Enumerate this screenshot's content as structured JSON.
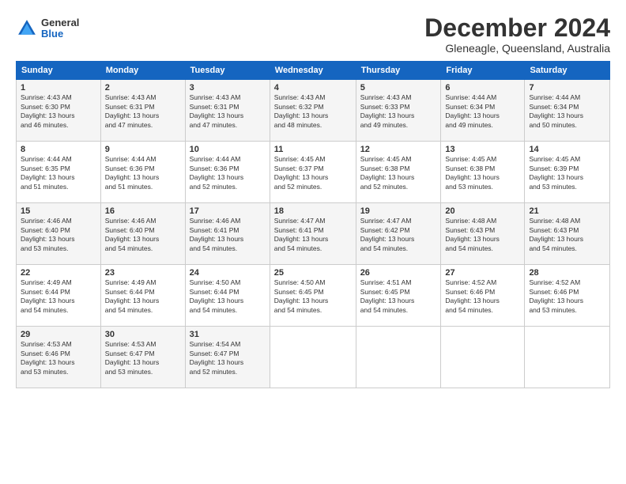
{
  "header": {
    "logo_general": "General",
    "logo_blue": "Blue",
    "main_title": "December 2024",
    "subtitle": "Gleneagle, Queensland, Australia"
  },
  "calendar": {
    "days_of_week": [
      "Sunday",
      "Monday",
      "Tuesday",
      "Wednesday",
      "Thursday",
      "Friday",
      "Saturday"
    ],
    "weeks": [
      [
        {
          "day": "",
          "info": ""
        },
        {
          "day": "",
          "info": ""
        },
        {
          "day": "",
          "info": ""
        },
        {
          "day": "",
          "info": ""
        },
        {
          "day": "",
          "info": ""
        },
        {
          "day": "",
          "info": ""
        },
        {
          "day": "",
          "info": ""
        }
      ]
    ],
    "cells": [
      {
        "day": "1",
        "sunrise": "4:43 AM",
        "sunset": "6:30 PM",
        "daylight": "13 hours and 46 minutes."
      },
      {
        "day": "2",
        "sunrise": "4:43 AM",
        "sunset": "6:31 PM",
        "daylight": "13 hours and 47 minutes."
      },
      {
        "day": "3",
        "sunrise": "4:43 AM",
        "sunset": "6:31 PM",
        "daylight": "13 hours and 47 minutes."
      },
      {
        "day": "4",
        "sunrise": "4:43 AM",
        "sunset": "6:32 PM",
        "daylight": "13 hours and 48 minutes."
      },
      {
        "day": "5",
        "sunrise": "4:43 AM",
        "sunset": "6:33 PM",
        "daylight": "13 hours and 49 minutes."
      },
      {
        "day": "6",
        "sunrise": "4:44 AM",
        "sunset": "6:34 PM",
        "daylight": "13 hours and 49 minutes."
      },
      {
        "day": "7",
        "sunrise": "4:44 AM",
        "sunset": "6:34 PM",
        "daylight": "13 hours and 50 minutes."
      },
      {
        "day": "8",
        "sunrise": "4:44 AM",
        "sunset": "6:35 PM",
        "daylight": "13 hours and 51 minutes."
      },
      {
        "day": "9",
        "sunrise": "4:44 AM",
        "sunset": "6:36 PM",
        "daylight": "13 hours and 51 minutes."
      },
      {
        "day": "10",
        "sunrise": "4:44 AM",
        "sunset": "6:36 PM",
        "daylight": "13 hours and 52 minutes."
      },
      {
        "day": "11",
        "sunrise": "4:45 AM",
        "sunset": "6:37 PM",
        "daylight": "13 hours and 52 minutes."
      },
      {
        "day": "12",
        "sunrise": "4:45 AM",
        "sunset": "6:38 PM",
        "daylight": "13 hours and 52 minutes."
      },
      {
        "day": "13",
        "sunrise": "4:45 AM",
        "sunset": "6:38 PM",
        "daylight": "13 hours and 53 minutes."
      },
      {
        "day": "14",
        "sunrise": "4:45 AM",
        "sunset": "6:39 PM",
        "daylight": "13 hours and 53 minutes."
      },
      {
        "day": "15",
        "sunrise": "4:46 AM",
        "sunset": "6:40 PM",
        "daylight": "13 hours and 53 minutes."
      },
      {
        "day": "16",
        "sunrise": "4:46 AM",
        "sunset": "6:40 PM",
        "daylight": "13 hours and 54 minutes."
      },
      {
        "day": "17",
        "sunrise": "4:46 AM",
        "sunset": "6:41 PM",
        "daylight": "13 hours and 54 minutes."
      },
      {
        "day": "18",
        "sunrise": "4:47 AM",
        "sunset": "6:41 PM",
        "daylight": "13 hours and 54 minutes."
      },
      {
        "day": "19",
        "sunrise": "4:47 AM",
        "sunset": "6:42 PM",
        "daylight": "13 hours and 54 minutes."
      },
      {
        "day": "20",
        "sunrise": "4:48 AM",
        "sunset": "6:43 PM",
        "daylight": "13 hours and 54 minutes."
      },
      {
        "day": "21",
        "sunrise": "4:48 AM",
        "sunset": "6:43 PM",
        "daylight": "13 hours and 54 minutes."
      },
      {
        "day": "22",
        "sunrise": "4:49 AM",
        "sunset": "6:44 PM",
        "daylight": "13 hours and 54 minutes."
      },
      {
        "day": "23",
        "sunrise": "4:49 AM",
        "sunset": "6:44 PM",
        "daylight": "13 hours and 54 minutes."
      },
      {
        "day": "24",
        "sunrise": "4:50 AM",
        "sunset": "6:44 PM",
        "daylight": "13 hours and 54 minutes."
      },
      {
        "day": "25",
        "sunrise": "4:50 AM",
        "sunset": "6:45 PM",
        "daylight": "13 hours and 54 minutes."
      },
      {
        "day": "26",
        "sunrise": "4:51 AM",
        "sunset": "6:45 PM",
        "daylight": "13 hours and 54 minutes."
      },
      {
        "day": "27",
        "sunrise": "4:52 AM",
        "sunset": "6:46 PM",
        "daylight": "13 hours and 54 minutes."
      },
      {
        "day": "28",
        "sunrise": "4:52 AM",
        "sunset": "6:46 PM",
        "daylight": "13 hours and 53 minutes."
      },
      {
        "day": "29",
        "sunrise": "4:53 AM",
        "sunset": "6:46 PM",
        "daylight": "13 hours and 53 minutes."
      },
      {
        "day": "30",
        "sunrise": "4:53 AM",
        "sunset": "6:47 PM",
        "daylight": "13 hours and 53 minutes."
      },
      {
        "day": "31",
        "sunrise": "4:54 AM",
        "sunset": "6:47 PM",
        "daylight": "13 hours and 52 minutes."
      }
    ]
  }
}
